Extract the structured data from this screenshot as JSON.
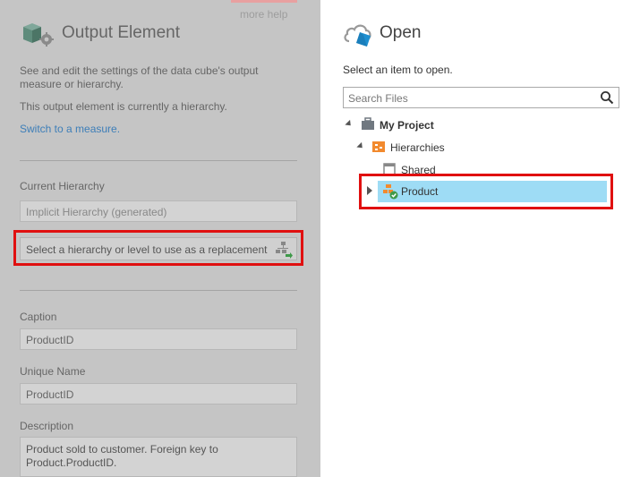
{
  "left_panel": {
    "more_help": "more help",
    "title": "Output Element",
    "desc1": "See and edit the settings of the data cube's output measure or hierarchy.",
    "desc2": "This output element is currently a hierarchy.",
    "switch_link": "Switch to a measure.",
    "current_hierarchy_label": "Current Hierarchy",
    "current_hierarchy_value": "Implicit Hierarchy (generated)",
    "replacement_text": "Select a hierarchy or level to use as a replacement",
    "caption_label": "Caption",
    "caption_value": "ProductID",
    "unique_name_label": "Unique Name",
    "unique_name_value": "ProductID",
    "description_label": "Description",
    "description_value": "Product sold to customer. Foreign key to Product.ProductID."
  },
  "right_panel": {
    "title": "Open",
    "subtitle": "Select an item to open.",
    "search_placeholder": "Search Files",
    "tree": {
      "project": "My Project",
      "hierarchies": "Hierarchies",
      "shared": "Shared",
      "product": "Product"
    }
  },
  "colors": {
    "highlight": "#e01010",
    "selection": "#9edcf5",
    "link": "#3d7eb8"
  }
}
